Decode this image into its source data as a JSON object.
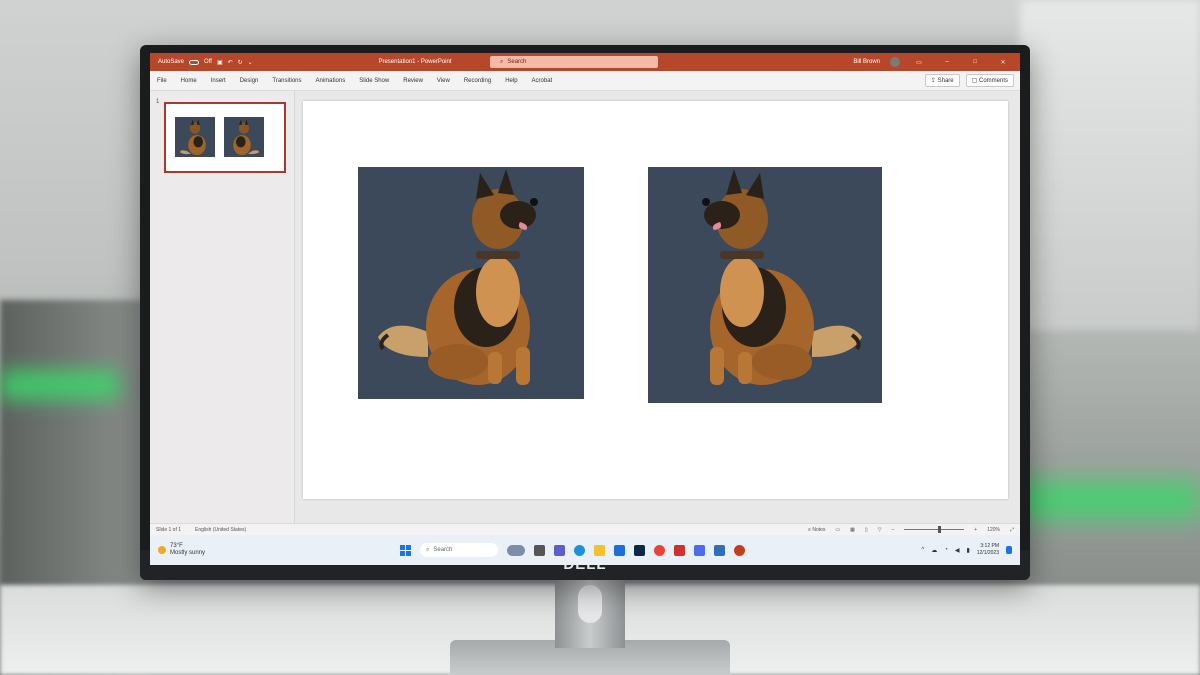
{
  "window": {
    "autosave_label": "AutoSave",
    "autosave_state": "Off",
    "doc_title": "Presentation1 - PowerPoint",
    "search_placeholder": "Search",
    "user_name": "Bill Brown"
  },
  "ribbon": {
    "tabs": [
      "File",
      "Home",
      "Insert",
      "Design",
      "Transitions",
      "Animations",
      "Slide Show",
      "Review",
      "View",
      "Recording",
      "Help",
      "Acrobat"
    ],
    "share_label": "Share",
    "comments_label": "Comments"
  },
  "thumbnails": {
    "slide_number": "1"
  },
  "status": {
    "slide_info": "Slide 1 of 1",
    "language": "English (United States)",
    "notes_label": "Notes",
    "zoom": "120%"
  },
  "taskbar": {
    "weather_temp": "73°F",
    "weather_desc": "Mostly sunny",
    "search_label": "Search",
    "time": "3:12 PM",
    "date": "12/1/2023"
  },
  "brand": {
    "monitor_logo": "DELL"
  },
  "colors": {
    "accent": "#b7472a",
    "photo_bg": "#3c495b"
  }
}
